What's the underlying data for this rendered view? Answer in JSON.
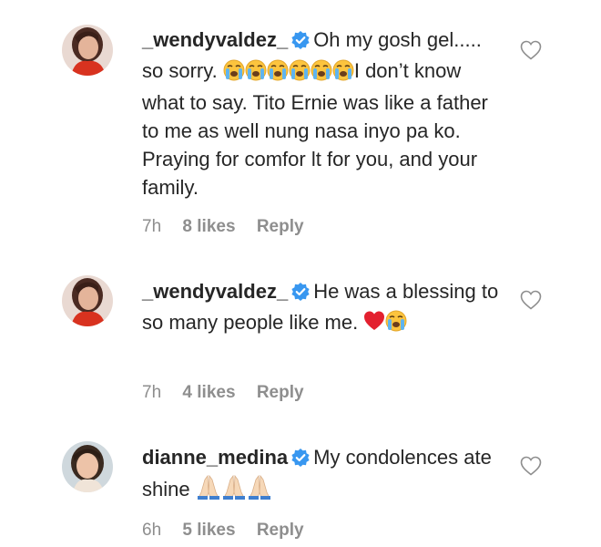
{
  "comments": [
    {
      "username": "_wendyvaldez_",
      "verified": true,
      "text_a": "Oh my gosh gel..... so sorry.",
      "emoji_a": "loudly-crying-face x6",
      "text_b": "I don’t know what to say. Tito Ernie was like a father to me as well nung nasa inyo pa ko. Praying for comfor lt for you, and your family.",
      "time": "7h",
      "likes": "8 likes",
      "reply": "Reply"
    },
    {
      "username": "_wendyvaldez_",
      "verified": true,
      "text_a": "He was a blessing to so many people like me.",
      "emoji_a": "red-heart, loudly-crying-face",
      "time": "7h",
      "likes": "4 likes",
      "reply": "Reply"
    },
    {
      "username": "dianne_medina",
      "verified": true,
      "text_a": "My condolences ate shine",
      "emoji_a": "folded-hands x3",
      "time": "6h",
      "likes": "5 likes",
      "reply": "Reply"
    }
  ],
  "colors": {
    "text": "#262626",
    "meta": "#8e8e8e",
    "verified": "#3897f0"
  }
}
